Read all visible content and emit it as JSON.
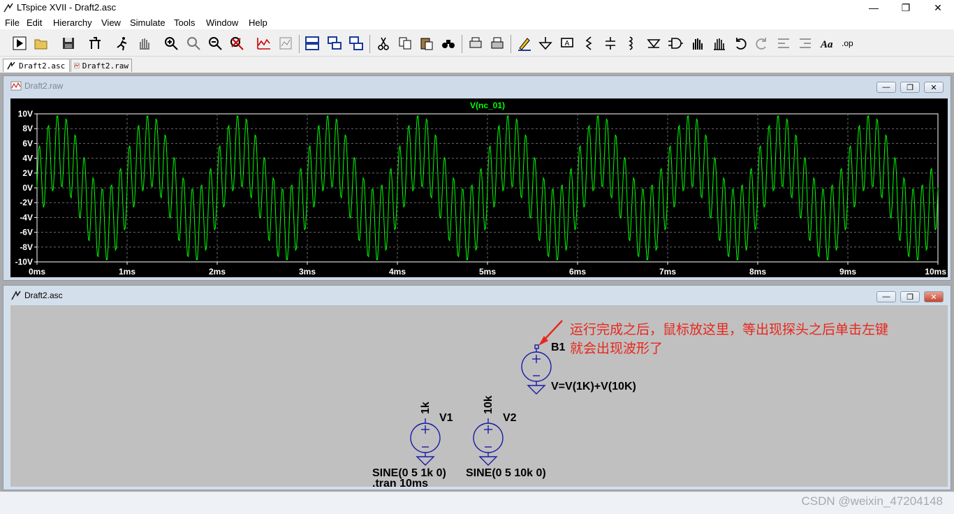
{
  "window": {
    "title": "LTspice XVII - Draft2.asc",
    "controls": {
      "minimize": "—",
      "maximize": "❐",
      "close": "✕"
    }
  },
  "menu": [
    "File",
    "Edit",
    "Hierarchy",
    "View",
    "Simulate",
    "Tools",
    "Window",
    "Help"
  ],
  "toolbar_icons": [
    "run-icon",
    "open-icon",
    "save-icon",
    "control-panel-icon",
    "halt-icon",
    "pan-hand-icon",
    "zoom-in-icon",
    "zoom-area-icon",
    "zoom-out-icon",
    "zoom-cancel-icon",
    "autorange-icon",
    "plot-settings-icon",
    "tile-horizontal-icon",
    "cascade-icon",
    "tile-vertical-icon",
    "cut-icon",
    "copy-icon",
    "paste-icon",
    "find-icon",
    "print-preview-icon",
    "print-icon",
    "label-net-icon",
    "ground-icon",
    "label-icon",
    "resistor-icon",
    "capacitor-icon",
    "inductor-icon",
    "diode-icon",
    "component-icon",
    "move-icon",
    "drag-icon",
    "undo-icon",
    "redo-icon",
    "rotate-icon",
    "mirror-icon",
    "text-icon",
    "spice-directive-icon"
  ],
  "doc_tabs": [
    {
      "label": "Draft2.asc",
      "icon": "schematic-icon"
    },
    {
      "label": "Draft2.raw",
      "icon": "waveform-icon"
    }
  ],
  "plot_window": {
    "title": "Draft2.raw",
    "buttons": {
      "minimize": "—",
      "restore": "❐",
      "close": "✕"
    }
  },
  "chart_data": {
    "type": "line",
    "title": "V(nc_01)",
    "series": [
      {
        "name": "V(nc_01)",
        "color": "#00ff00",
        "formula": "5*sin(2*pi*1000*t) + 5*sin(2*pi*10000*t)",
        "x_start_ms": 0,
        "x_end_ms": 10,
        "sample_count": 1001
      }
    ],
    "x_ticks": [
      "0ms",
      "1ms",
      "2ms",
      "3ms",
      "4ms",
      "5ms",
      "6ms",
      "7ms",
      "8ms",
      "9ms",
      "10ms"
    ],
    "y_ticks": [
      "10V",
      "8V",
      "6V",
      "4V",
      "2V",
      "0V",
      "-2V",
      "-4V",
      "-6V",
      "-8V",
      "-10V"
    ],
    "xlim": [
      0,
      10
    ],
    "ylim": [
      -10,
      10
    ],
    "grid": true,
    "grid_color": "#6a6a6a",
    "background": "#000000",
    "axis_text_color": "#ffffff"
  },
  "schematic_window": {
    "title": "Draft2.asc",
    "buttons": {
      "minimize": "—",
      "restore": "❐",
      "close": "✕"
    }
  },
  "schematic": {
    "B1": {
      "name": "B1",
      "value": "V=V(1K)+V(10K)"
    },
    "V1": {
      "name": "V1",
      "net": "1k",
      "value": "SINE(0 5 1k 0)"
    },
    "V2": {
      "name": "V2",
      "net": "10k",
      "value": "SINE(0 5 10k 0)"
    },
    "directive": ".tran 10ms",
    "annotation_line1": "运行完成之后，鼠标放这里，等出现探头之后单击左键",
    "annotation_line2": "就会出现波形了",
    "annotation_color": "#e8271c",
    "wire_color": "#1a1aa8"
  },
  "watermark": "CSDN @weixin_47204148"
}
